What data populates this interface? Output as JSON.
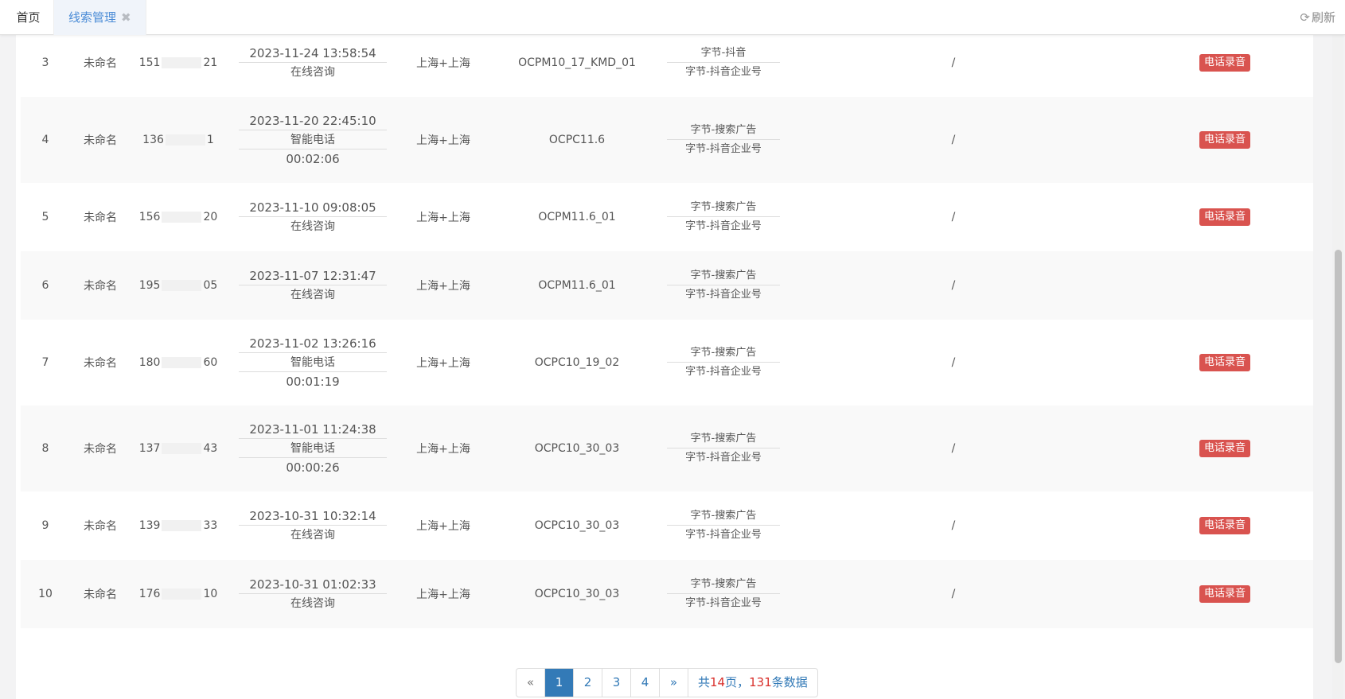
{
  "tabs": {
    "home_label": "首页",
    "active_label": "线索管理",
    "close_glyph": "✖",
    "refresh_label": "刷新",
    "refresh_icon": "refresh-icon"
  },
  "rows": [
    {
      "index": "3",
      "name": "未命名",
      "phone_prefix": "151",
      "phone_suffix": "21",
      "time": "2023-11-24 13:58:54",
      "channel": "在线咨询",
      "duration": "",
      "region": "上海+上海",
      "plan": "OCPM10_17_KMD_01",
      "source1": "字节-抖音",
      "source2": "字节-抖音企业号",
      "remark": "/",
      "action": "电话录音"
    },
    {
      "index": "4",
      "name": "未命名",
      "phone_prefix": "136",
      "phone_suffix": "1",
      "time": "2023-11-20 22:45:10",
      "channel": "智能电话",
      "duration": "00:02:06",
      "region": "上海+上海",
      "plan": "OCPC11.6",
      "source1": "字节-搜索广告",
      "source2": "字节-抖音企业号",
      "remark": "/",
      "action": "电话录音"
    },
    {
      "index": "5",
      "name": "未命名",
      "phone_prefix": "156",
      "phone_suffix": "20",
      "time": "2023-11-10 09:08:05",
      "channel": "在线咨询",
      "duration": "",
      "region": "上海+上海",
      "plan": "OCPM11.6_01",
      "source1": "字节-搜索广告",
      "source2": "字节-抖音企业号",
      "remark": "/",
      "action": "电话录音"
    },
    {
      "index": "6",
      "name": "未命名",
      "phone_prefix": "195",
      "phone_suffix": "05",
      "time": "2023-11-07 12:31:47",
      "channel": "在线咨询",
      "duration": "",
      "region": "上海+上海",
      "plan": "OCPM11.6_01",
      "source1": "字节-搜索广告",
      "source2": "字节-抖音企业号",
      "remark": "/",
      "action": ""
    },
    {
      "index": "7",
      "name": "未命名",
      "phone_prefix": "180",
      "phone_suffix": "60",
      "time": "2023-11-02 13:26:16",
      "channel": "智能电话",
      "duration": "00:01:19",
      "region": "上海+上海",
      "plan": "OCPC10_19_02",
      "source1": "字节-搜索广告",
      "source2": "字节-抖音企业号",
      "remark": "/",
      "action": "电话录音"
    },
    {
      "index": "8",
      "name": "未命名",
      "phone_prefix": "137",
      "phone_suffix": "43",
      "time": "2023-11-01 11:24:38",
      "channel": "智能电话",
      "duration": "00:00:26",
      "region": "上海+上海",
      "plan": "OCPC10_30_03",
      "source1": "字节-搜索广告",
      "source2": "字节-抖音企业号",
      "remark": "/",
      "action": "电话录音"
    },
    {
      "index": "9",
      "name": "未命名",
      "phone_prefix": "139",
      "phone_suffix": "33",
      "time": "2023-10-31 10:32:14",
      "channel": "在线咨询",
      "duration": "",
      "region": "上海+上海",
      "plan": "OCPC10_30_03",
      "source1": "字节-搜索广告",
      "source2": "字节-抖音企业号",
      "remark": "/",
      "action": "电话录音"
    },
    {
      "index": "10",
      "name": "未命名",
      "phone_prefix": "176",
      "phone_suffix": "10",
      "time": "2023-10-31 01:02:33",
      "channel": "在线咨询",
      "duration": "",
      "region": "上海+上海",
      "plan": "OCPC10_30_03",
      "source1": "字节-搜索广告",
      "source2": "字节-抖音企业号",
      "remark": "/",
      "action": "电话录音"
    }
  ],
  "pager": {
    "prev": "«",
    "pages": [
      "1",
      "2",
      "3",
      "4"
    ],
    "current": "1",
    "next": "»",
    "info_prefix": "共",
    "total_pages": "14",
    "info_mid": "页，",
    "total_records": "131",
    "info_suffix": "条数据"
  },
  "colors": {
    "accent": "#337ab7",
    "danger": "#d9534f",
    "tab_active_text": "#4a8bd6"
  }
}
